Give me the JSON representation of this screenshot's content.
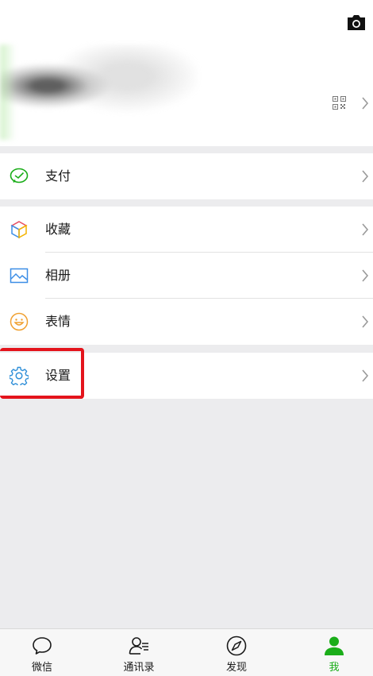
{
  "header": {
    "camera_icon": "camera-icon",
    "qr_icon": "qr-code-icon"
  },
  "menu": {
    "pay": {
      "label": "支付",
      "icon": "wechat-pay-icon"
    },
    "favorites": {
      "label": "收藏",
      "icon": "cube-favorites-icon"
    },
    "album": {
      "label": "相册",
      "icon": "photo-album-icon"
    },
    "stickers": {
      "label": "表情",
      "icon": "smiley-icon"
    },
    "settings": {
      "label": "设置",
      "icon": "gear-icon"
    }
  },
  "tabs": [
    {
      "label": "微信",
      "icon": "chat-bubble-icon"
    },
    {
      "label": "通讯录",
      "icon": "contacts-icon"
    },
    {
      "label": "发现",
      "icon": "compass-icon"
    },
    {
      "label": "我",
      "icon": "person-icon",
      "active": true
    }
  ],
  "colors": {
    "accent": "#1aad19",
    "highlight": "#e4141c",
    "background": "#ececee"
  }
}
